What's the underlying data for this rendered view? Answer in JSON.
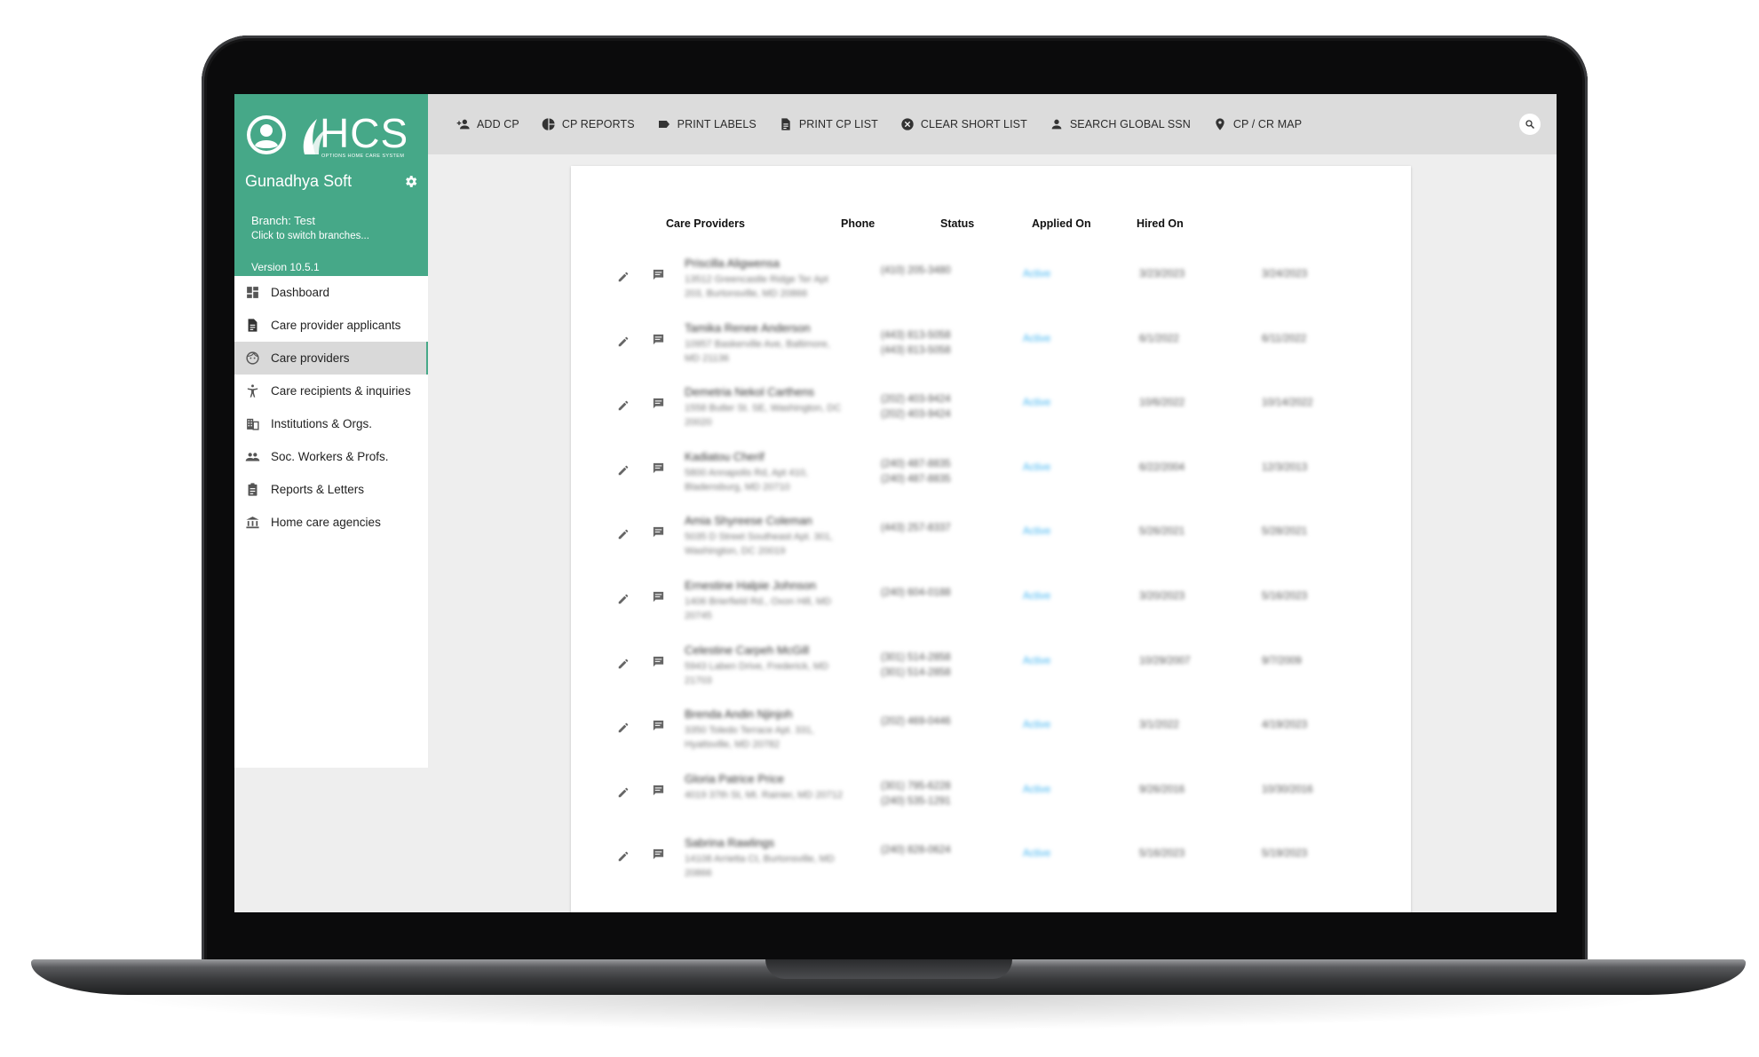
{
  "app": {
    "logo": "HCS",
    "logo_subtitle": "OPTIONS HOME CARE SYSTEM",
    "org_name": "Gunadhya Soft",
    "branch": "Branch: Test",
    "switch_hint": "Click to switch branches...",
    "version": "Version 10.5.1",
    "accent_color": "#46a888",
    "status_color": "#3fb3f0"
  },
  "toolbar": {
    "buttons": [
      {
        "label": "ADD CP",
        "icon": "person-add-icon"
      },
      {
        "label": "CP REPORTS",
        "icon": "pie-chart-icon"
      },
      {
        "label": "PRINT LABELS",
        "icon": "label-icon"
      },
      {
        "label": "PRINT CP LIST",
        "icon": "document-icon"
      },
      {
        "label": "CLEAR SHORT LIST",
        "icon": "cancel-circle-icon"
      },
      {
        "label": "SEARCH GLOBAL SSN",
        "icon": "person-icon"
      },
      {
        "label": "CP / CR MAP",
        "icon": "map-pin-icon"
      }
    ],
    "search_icon": "search-icon"
  },
  "sidebar": {
    "items": [
      {
        "label": "Dashboard",
        "icon": "dashboard-icon"
      },
      {
        "label": "Care provider applicants",
        "icon": "document-icon"
      },
      {
        "label": "Care providers",
        "icon": "face-icon",
        "active": true
      },
      {
        "label": "Care recipients & inquiries",
        "icon": "accessibility-icon"
      },
      {
        "label": "Institutions & Orgs.",
        "icon": "building-icon"
      },
      {
        "label": "Soc. Workers & Profs.",
        "icon": "people-icon"
      },
      {
        "label": "Reports & Letters",
        "icon": "clipboard-icon"
      },
      {
        "label": "Home care agencies",
        "icon": "institution-icon"
      }
    ]
  },
  "table": {
    "headers": {
      "care_providers": "Care Providers",
      "phone": "Phone",
      "status": "Status",
      "applied_on": "Applied On",
      "hired_on": "Hired On"
    },
    "rows": [
      {
        "name": "Priscilla Aligwensa",
        "address": "13512 Greencastle Ridge Ter Apt 203, Burtonsville, MD 20866",
        "phone": "(410) 205-3480",
        "status": "Active",
        "applied": "3/23/2023",
        "hired": "3/24/2023"
      },
      {
        "name": "Tamika Renee Anderson",
        "address": "10957 Baskerville Ave, Baltimore, MD 21136",
        "phone": "(443) 813-5058\n(443) 813-5058",
        "status": "Active",
        "applied": "6/1/2022",
        "hired": "6/11/2022"
      },
      {
        "name": "Demetria Nekol Carthens",
        "address": "1558 Butler St. SE, Washington, DC 20020",
        "phone": "(202) 403-9424\n(202) 403-9424",
        "status": "Active",
        "applied": "10/6/2022",
        "hired": "10/14/2022"
      },
      {
        "name": "Kadiatou Cherif",
        "address": "5800 Annapolis Rd, Apt 410, Bladensburg, MD 20710",
        "phone": "(240) 487-8835\n(240) 487-8835",
        "status": "Active",
        "applied": "6/22/2004",
        "hired": "12/3/2013"
      },
      {
        "name": "Amia Shyreese Coleman",
        "address": "5035 D Street Southeast Apt. 301, Washington, DC 20019",
        "phone": "(443) 257-8337",
        "status": "Active",
        "applied": "5/26/2021",
        "hired": "5/28/2021"
      },
      {
        "name": "Ernestine Halpie Johnson",
        "address": "1406 Brierfield Rd., Oxon Hill, MD 20745",
        "phone": "(240) 604-0188",
        "status": "Active",
        "applied": "3/20/2023",
        "hired": "5/16/2023"
      },
      {
        "name": "Celestine Carpeh McGill",
        "address": "5943 Laben Drive, Frederick, MD 21703",
        "phone": "(301) 514-2858\n(301) 514-2858",
        "status": "Active",
        "applied": "10/29/2007",
        "hired": "9/7/2009"
      },
      {
        "name": "Brenda Andin Njinjoh",
        "address": "3350 Toledo Terrace Apt. 331, Hyattsville, MD 20782",
        "phone": "(202) 469-0446",
        "status": "Active",
        "applied": "3/1/2022",
        "hired": "4/19/2023"
      },
      {
        "name": "Gloria Patrice Price",
        "address": "4019 37th St, Mt. Rainier, MD 20712",
        "phone": "(301) 795-6228\n(240) 535-1291",
        "status": "Active",
        "applied": "9/26/2016",
        "hired": "10/30/2016"
      },
      {
        "name": "Sabrina Rawlings",
        "address": "14108 Arrietta Ct, Burtonsville, MD 20866",
        "phone": "(240) 828-0624",
        "status": "Active",
        "applied": "5/16/2023",
        "hired": "5/19/2023"
      }
    ]
  }
}
